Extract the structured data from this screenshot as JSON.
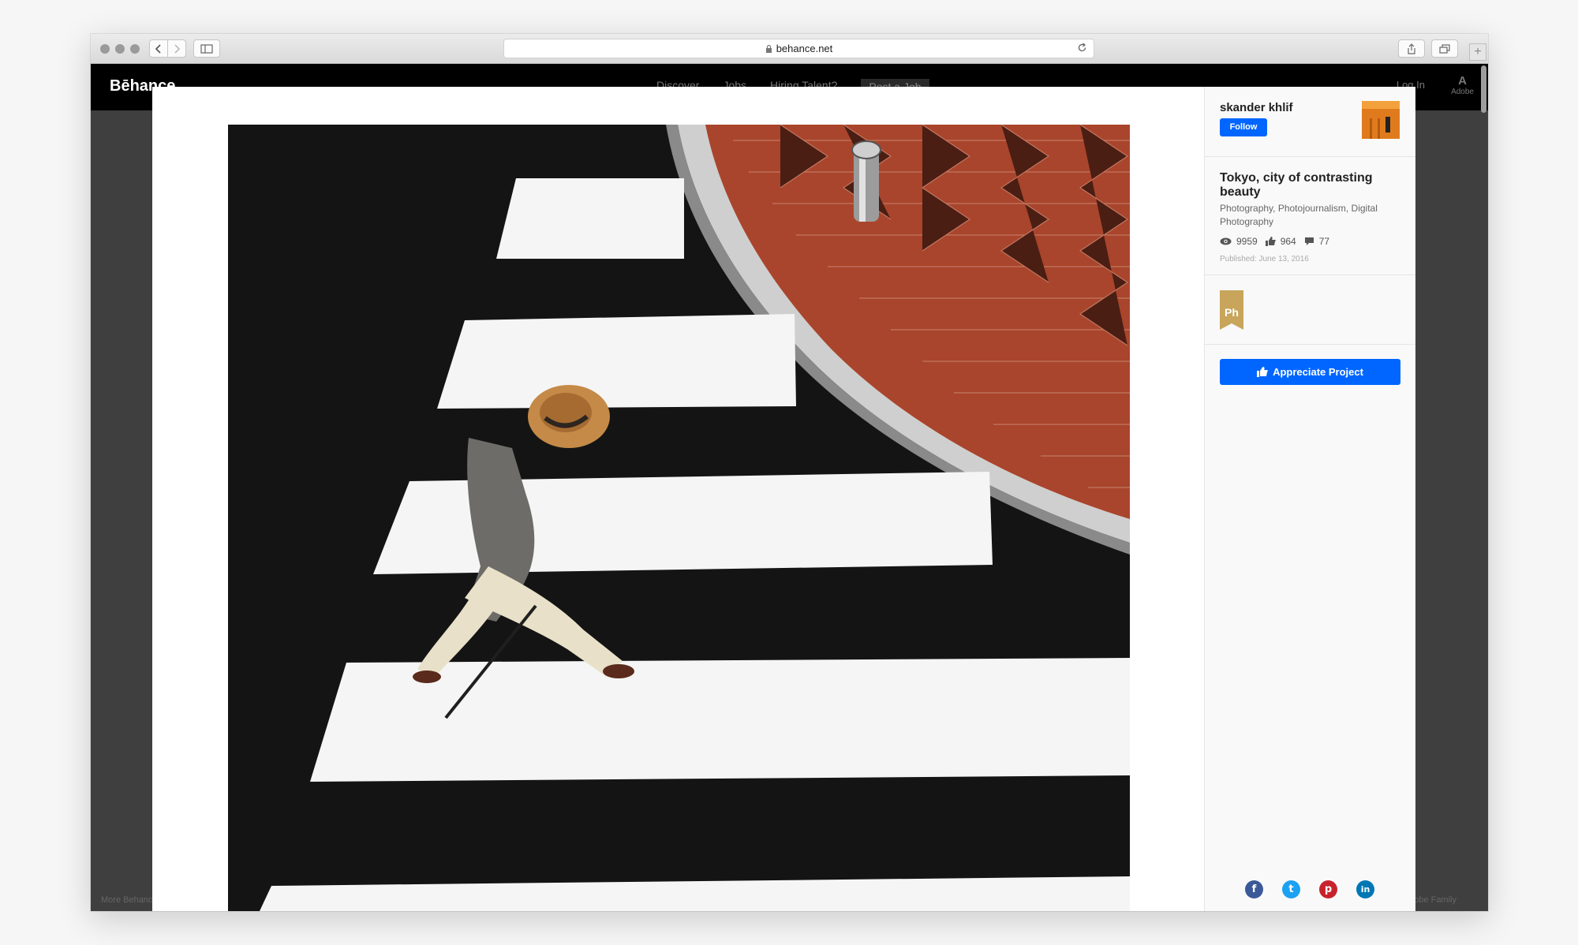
{
  "browser": {
    "url": "behance.net"
  },
  "site": {
    "logo": "Bēhance",
    "nav": [
      "Discover",
      "Jobs",
      "Hiring Talent?",
      "Post a Job"
    ],
    "login": "Log In",
    "adobe": "Adobe",
    "footer_left": "More Behance",
    "footer_right": "Adobe Family"
  },
  "project": {
    "owner_name": "skander khlif",
    "follow_label": "Follow",
    "title": "Tokyo, city of contrasting beauty",
    "fields": "Photography, Photojournalism, Digital Photography",
    "views": "9959",
    "appreciations": "964",
    "comments": "77",
    "published": "Published: June 13, 2016",
    "tool_badge": "Ph",
    "appreciate_label": "Appreciate Project"
  },
  "share": {
    "facebook": "f",
    "twitter": "t",
    "pinterest": "p",
    "linkedin": "in"
  },
  "colors": {
    "accent": "#0066ff",
    "tool_badge": "#c8a55a"
  }
}
